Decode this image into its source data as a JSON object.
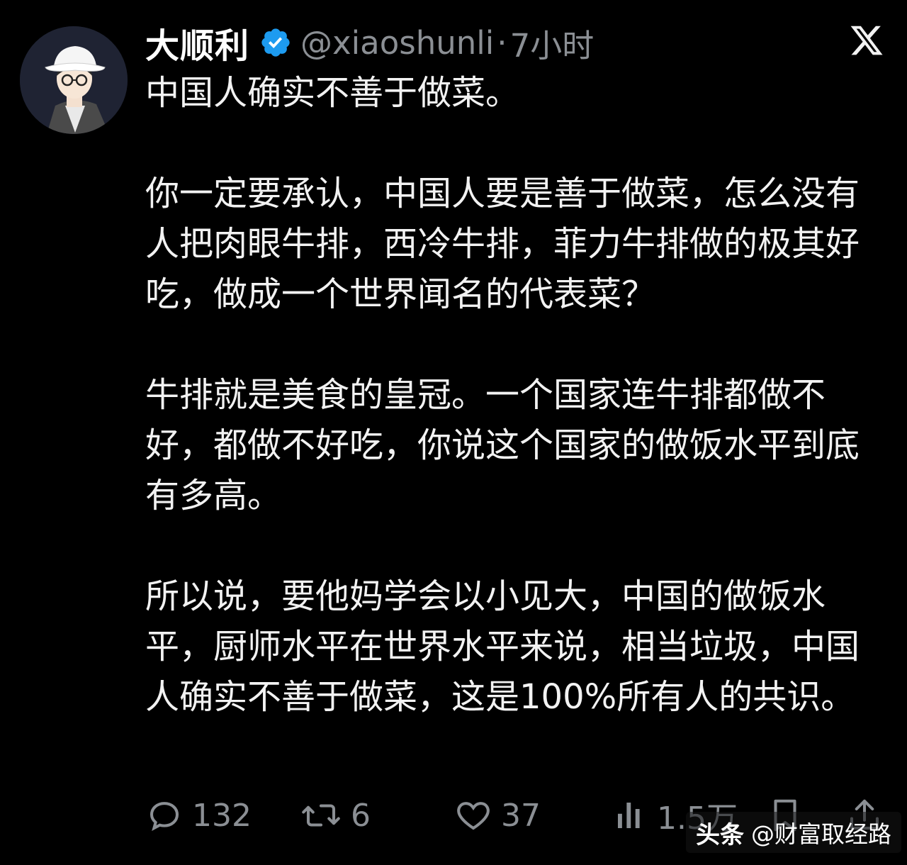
{
  "author": {
    "display_name": "大顺利",
    "handle": "@xiaoshunli",
    "separator": "·",
    "time": "7小时"
  },
  "tweet": {
    "paragraphs": [
      "中国人确实不善于做菜。",
      "你一定要承认，中国人要是善于做菜，怎么没有人把肉眼牛排，西冷牛排，菲力牛排做的极其好吃，做成一个世界闻名的代表菜？",
      "牛排就是美食的皇冠。一个国家连牛排都做不好，都做不好吃，你说这个国家的做饭水平到底有多高。",
      "所以说，要他妈学会以小见大，中国的做饭水平，厨师水平在世界水平来说，相当垃圾，中国人确实不善于做菜，这是100%所有人的共识。"
    ]
  },
  "actions": {
    "reply_count": "132",
    "retweet_count": "6",
    "like_count": "37",
    "views_count": "1.5万"
  },
  "watermark": {
    "logo": "头条",
    "text": "@财富取经路"
  },
  "icons": {
    "verified": "verified-badge-icon",
    "close": "x-logo-icon",
    "reply": "reply-icon",
    "retweet": "retweet-icon",
    "like": "heart-icon",
    "views": "views-icon",
    "bookmark": "bookmark-icon",
    "share": "share-icon"
  },
  "colors": {
    "background": "#000000",
    "text": "#f2f2f2",
    "muted": "#8b8f94",
    "verified": "#1d9bf0"
  }
}
